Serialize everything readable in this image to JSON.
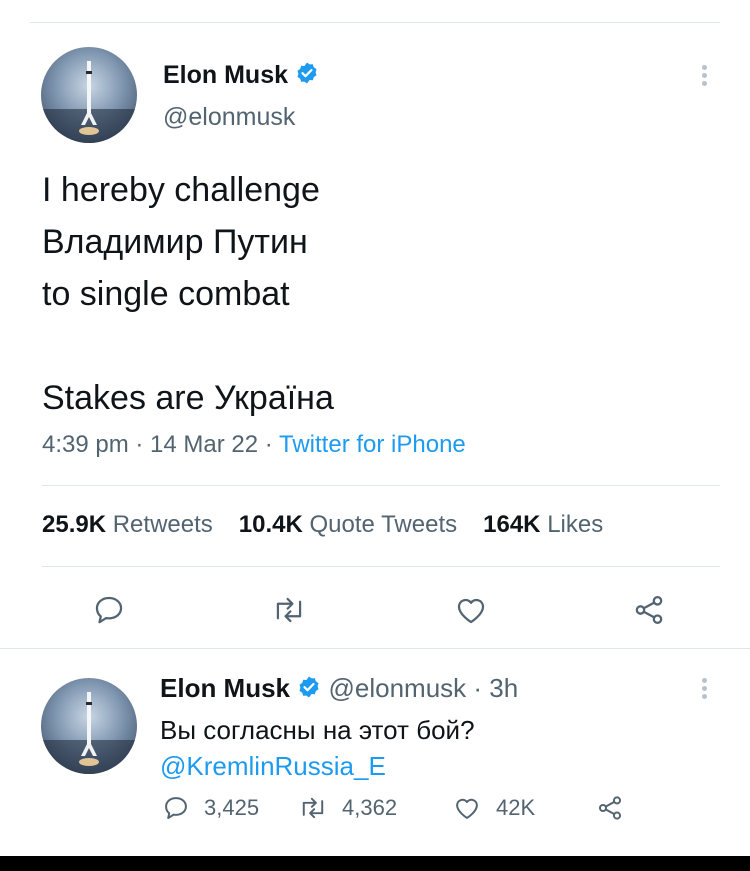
{
  "main_tweet": {
    "author_name": "Elon Musk",
    "author_handle": "@elonmusk",
    "text_lines": [
      "I hereby challenge",
      "Владимир Путин",
      "to single combat",
      "",
      "Stakes are Україна"
    ],
    "time": "4:39 pm",
    "date": "14 Mar 22",
    "source": "Twitter for iPhone",
    "separator": " · ",
    "stats": {
      "retweets_count": "25.9K",
      "retweets_label": "Retweets",
      "quotes_count": "10.4K",
      "quotes_label": "Quote Tweets",
      "likes_count": "164K",
      "likes_label": "Likes"
    },
    "actions": [
      "reply-icon",
      "retweet-icon",
      "like-icon",
      "share-icon"
    ]
  },
  "reply_tweet": {
    "author_name": "Elon Musk",
    "author_handle": "@elonmusk",
    "dot": " · ",
    "time_ago": "3h",
    "text": "Вы согласны на этот бой?",
    "mention": "@KremlinRussia_E",
    "replies": "3,425",
    "retweets": "4,362",
    "likes": "42K"
  },
  "colors": {
    "accent": "#1d9bf0",
    "text": "#0f1419",
    "secondary": "#536471",
    "divider": "#e1e6ea"
  }
}
